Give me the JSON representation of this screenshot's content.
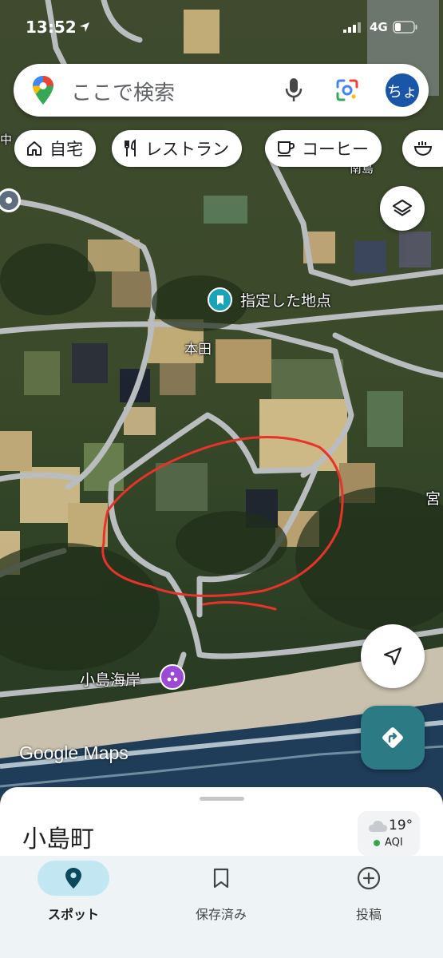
{
  "status_bar": {
    "time": "13:52",
    "network": "4G"
  },
  "search": {
    "placeholder": "ここで検索",
    "avatar_text": "ちょ"
  },
  "chips": [
    {
      "label": "自宅",
      "icon": "home-icon"
    },
    {
      "label": "レストラン",
      "icon": "restaurant-icon"
    },
    {
      "label": "コーヒー",
      "icon": "coffee-icon"
    }
  ],
  "map": {
    "labels": {
      "pinned_point": "指定した地点",
      "honden": "本田",
      "beach": "小島海岸",
      "edge_right": "宮",
      "edge_left": "中",
      "top_right": "南島"
    },
    "watermark": "Google Maps",
    "annotation": "red hand-drawn circle"
  },
  "sheet": {
    "title": "小島町",
    "weather": {
      "temp": "19°",
      "aqi": "AQI",
      "icon": "cloud-icon"
    }
  },
  "nav": {
    "items": [
      {
        "label": "スポット",
        "icon": "location-pin-icon",
        "active": true
      },
      {
        "label": "保存済み",
        "icon": "bookmark-icon",
        "active": false
      },
      {
        "label": "投稿",
        "icon": "add-circle-icon",
        "active": false
      }
    ]
  },
  "colors": {
    "accent": "#1a56a8",
    "directions_fab": "#2b7a84",
    "active_tab": "#c2e7f3",
    "annotation": "#e8322b"
  }
}
